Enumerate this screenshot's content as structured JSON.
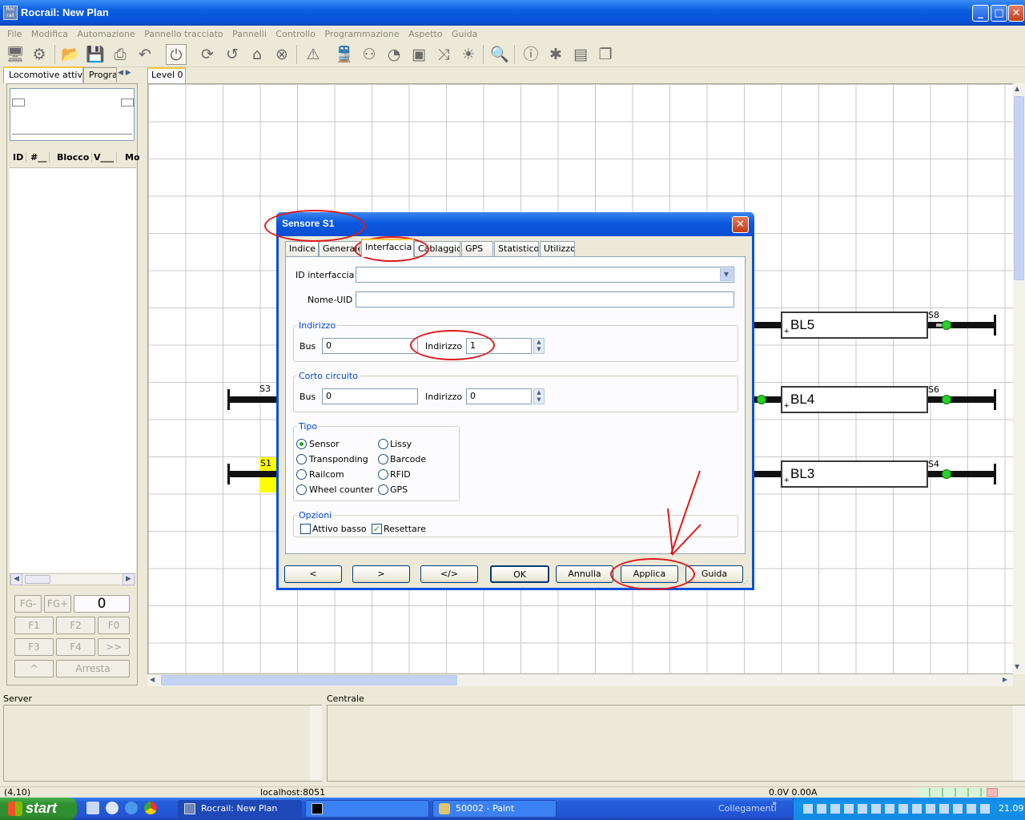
{
  "window": {
    "title": "Rocrail: New Plan",
    "icon_label": "Roc rail"
  },
  "menu": [
    "File",
    "Modifica",
    "Automazione",
    "Pannello tracciato",
    "Pannelli",
    "Controllo",
    "Programmazione",
    "Aspetto",
    "Guida"
  ],
  "left": {
    "tabs": [
      "Locomotive attive",
      "Prograr"
    ],
    "columns": [
      "ID",
      "#__",
      "Blocco",
      "V___",
      "Mo"
    ],
    "fg_minus": "FG-",
    "fg_plus": "FG+",
    "speed": "0",
    "f1": "F1",
    "f2": "F2",
    "f0": "F0",
    "f3": "F3",
    "f4": "F4",
    "more": ">>",
    "up": "^",
    "stop": "Arresta"
  },
  "plan": {
    "tab": "Level 0",
    "blocks": {
      "bl5": "BL5",
      "bl4": "BL4",
      "bl3": "BL3"
    },
    "sensors": {
      "s8": "S8",
      "s6": "S6",
      "s4": "S4",
      "s3": "S3",
      "s1": "S1"
    }
  },
  "dialog": {
    "title": "Sensore S1",
    "tabs": [
      "Indice",
      "Generale",
      "Interfaccia",
      "Cablaggio",
      "GPS",
      "Statistico",
      "Utilizzo"
    ],
    "selected_tab": "Interfaccia",
    "id_interfaccia_label": "ID interfaccia",
    "id_interfaccia_value": "",
    "nome_uid_label": "Nome-UID",
    "nome_uid_value": "",
    "indirizzo_group": "Indirizzo",
    "bus_label": "Bus",
    "bus_value": "0",
    "indirizzo_label": "Indirizzo",
    "indirizzo_value": "1",
    "corto_group": "Corto circuito",
    "cc_bus_label": "Bus",
    "cc_bus_value": "0",
    "cc_indirizzo_label": "Indirizzo",
    "cc_indirizzo_value": "0",
    "tipo_group": "Tipo",
    "tipo_options": [
      "Sensor",
      "Transponding",
      "Railcom",
      "Wheel counter",
      "Lissy",
      "Barcode",
      "RFID",
      "GPS"
    ],
    "tipo_selected": "Sensor",
    "opzioni_group": "Opzioni",
    "attivo_basso": "Attivo basso",
    "attivo_basso_checked": false,
    "resettare": "Resettare",
    "resettare_checked": true,
    "buttons": {
      "prev": "<",
      "next": ">",
      "xml": "</>",
      "ok": "OK",
      "cancel": "Annulla",
      "apply": "Applica",
      "help": "Guida"
    }
  },
  "bottom": {
    "server": "Server",
    "centrale": "Centrale"
  },
  "status": {
    "coords": "(4,10)",
    "host": "localhost:8051",
    "power": "0.0V 0.00A"
  },
  "taskbar": {
    "start": "start",
    "tasks": [
      "Rocrail: New Plan",
      "",
      "50002 - Paint"
    ],
    "links": "Collegamenti",
    "clock": "21.09"
  },
  "colors": {
    "sensor_on": "#25d325",
    "annotation": "#e0191b",
    "selected_sensor": "#ffff00",
    "xp_blue": "#0a58df"
  }
}
